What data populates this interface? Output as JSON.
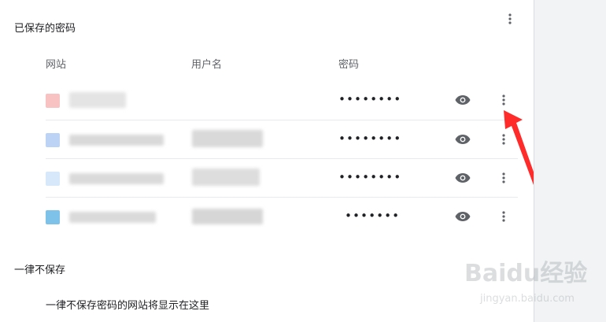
{
  "saved_passwords": {
    "title": "已保存的密码",
    "menu_icon": "more-vert-icon",
    "columns": {
      "site": "网站",
      "username": "用户名",
      "password": "密码"
    },
    "rows": [
      {
        "site": "",
        "username": "",
        "password": "••••••••",
        "favicon_color": "#f8c4c4",
        "site_blur": "#e0e0e0",
        "user_blur": ""
      },
      {
        "site": "",
        "username": "",
        "password": "••••••••",
        "favicon_color": "#bcd3f5",
        "site_blur": "#d5d5d5",
        "user_blur": "#d5d5d5"
      },
      {
        "site": "",
        "username": "",
        "password": "••••••••",
        "favicon_color": "#d6e8fa",
        "site_blur": "#d8d8d8",
        "user_blur": "#dadada"
      },
      {
        "site": "",
        "username": "",
        "password": "•••••••",
        "favicon_color": "#7ec2ea",
        "site_blur": "#d8d8d8",
        "user_blur": "#d5d5d5"
      }
    ]
  },
  "never_saved": {
    "title": "一律不保存",
    "empty_text": "一律不保存密码的网站将显示在这里"
  },
  "watermark": {
    "brand": "Baidu经验",
    "sub": "jingyan.baidu.com"
  },
  "colors": {
    "accent": "#ff2a2a",
    "icon": "#5f6368",
    "divider": "#e8eaed"
  }
}
